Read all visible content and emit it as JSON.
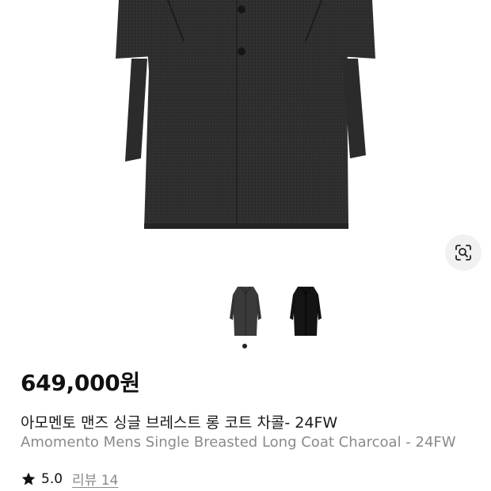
{
  "product": {
    "price": "649,000원",
    "title_ko": "아모멘토 맨즈 싱글 브레스트 롱 코트 차콜- 24FW",
    "title_en": "Amomento Mens Single Breasted Long Coat Charcoal - 24FW",
    "rating": "5.0",
    "review_link": "리뷰 14"
  },
  "gallery": {
    "thumbnails": [
      {
        "color": "charcoal",
        "fill": "#333333"
      },
      {
        "color": "black",
        "fill": "#111111"
      }
    ],
    "active_index": 0
  },
  "icons": {
    "lens": "image-search-icon",
    "star": "star-icon"
  }
}
